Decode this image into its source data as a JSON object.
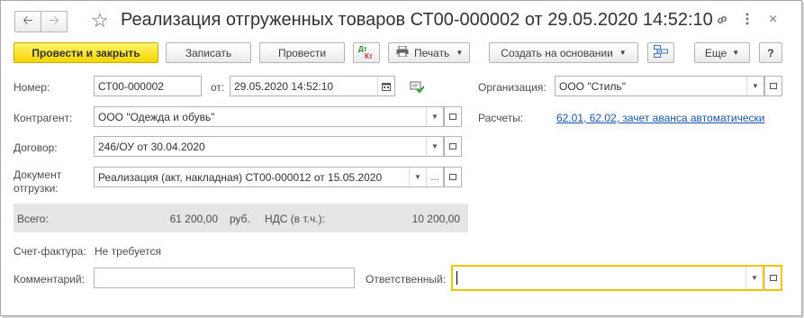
{
  "window": {
    "title": "Реализация отгруженных товаров СТ00-000002 от 29.05.2020 14:52:10",
    "icons": [
      "back-arrow-icon",
      "forward-arrow-icon",
      "star-icon",
      "link-icon",
      "more-vertical-icon",
      "close-icon"
    ]
  },
  "toolbar": {
    "post_close": "Провести и закрыть",
    "save": "Записать",
    "post": "Провести",
    "dtkt_dt": "Дт",
    "dtkt_kt": "Кт",
    "print": "Печать",
    "create_based": "Создать на основании",
    "more": "Еще",
    "help": "?"
  },
  "form": {
    "number_label": "Номер:",
    "number_value": "СТ00-000002",
    "date_label": "от:",
    "date_value": "29.05.2020 14:52:10",
    "org_label": "Организация:",
    "org_value": "ООО \"Стиль\"",
    "contractor_label": "Контрагент:",
    "contractor_value": "ООО \"Одежда и обувь\"",
    "settlements_label": "Расчеты:",
    "settlements_link": "62.01, 62.02, зачет аванса автоматически",
    "contract_label": "Договор:",
    "contract_value": "246/ОУ от 30.04.2020",
    "shipment_doc_label_1": "Документ",
    "shipment_doc_label_2": "отгрузки:",
    "shipment_doc_value": "Реализация (акт, накладная) СТ00-000012 от 15.05.2020",
    "ellipsis": "...",
    "total_label": "Всего:",
    "total_value": "61 200,00",
    "currency": "руб.",
    "vat_label": "НДС (в т.ч.):",
    "vat_value": "10 200,00",
    "invoice_label": "Счет-фактура:",
    "invoice_value": "Не требуется",
    "comment_label": "Комментарий:",
    "comment_value": "",
    "responsible_label": "Ответственный:",
    "responsible_value": ""
  },
  "colors": {
    "primary_button": "#f5d500",
    "link": "#1a56a8",
    "focus_border": "#f0c400",
    "totals_background": "#e5e5e5"
  }
}
